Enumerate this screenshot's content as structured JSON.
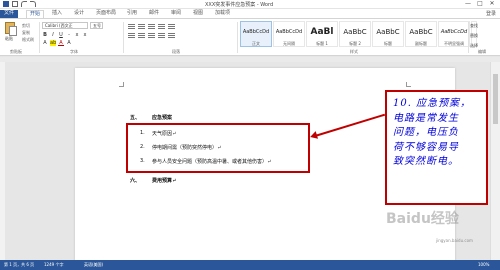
{
  "window": {
    "title": "XXX突发事件应急预案 - Word",
    "minimize": "—",
    "maximize": "□",
    "close": "✕"
  },
  "tabs": [
    {
      "label": "文件"
    },
    {
      "label": "开始"
    },
    {
      "label": "插入"
    },
    {
      "label": "设计"
    },
    {
      "label": "页面布局"
    },
    {
      "label": "引用"
    },
    {
      "label": "邮件"
    },
    {
      "label": "审阅"
    },
    {
      "label": "视图"
    },
    {
      "label": "加载项"
    }
  ],
  "login": "登录",
  "ribbon": {
    "paste_label": "粘贴",
    "cut": "剪切",
    "copy": "复制",
    "format_painter": "格式刷",
    "font_name": "Calibri (西文正",
    "font_size": "五号",
    "bold": "B",
    "italic": "I",
    "underline": "U",
    "groups": {
      "clipboard": "剪贴板",
      "font": "字体",
      "paragraph": "段落",
      "styles": "样式",
      "editing": "编辑"
    },
    "styles": [
      {
        "sample": "AaBbCcDd",
        "name": "正文"
      },
      {
        "sample": "AaBbCcDd",
        "name": "无间隔"
      },
      {
        "sample": "AaBl",
        "name": "标题 1"
      },
      {
        "sample": "AaBbC",
        "name": "标题 2"
      },
      {
        "sample": "AaBbC",
        "name": "标题"
      },
      {
        "sample": "AaBbC",
        "name": "副标题"
      },
      {
        "sample": "AaBbCcDd",
        "name": "不明显强调"
      }
    ],
    "find": "查找",
    "replace": "替换",
    "select": "选择"
  },
  "document": {
    "section5_num": "五、",
    "section5_title": "应急预案",
    "items": [
      {
        "num": "1.",
        "text": "天气原因↵"
      },
      {
        "num": "2.",
        "text": "停电期间需（预防突然停电）↵"
      },
      {
        "num": "3.",
        "text": "参与人员安全问题（预防高温中暑、或者其他伤害）↵"
      }
    ],
    "section6_num": "六、",
    "section6_title": "费用预算↵"
  },
  "annotation": {
    "text": "10. 应急预案，\n电路是常发生\n问题，电压负\n荷不够容易导\n致突然断电。"
  },
  "status": {
    "page": "第 1 页，共 6 页",
    "words": "1249 个字",
    "lang": "英语(美国)",
    "zoom": "100%"
  },
  "watermark": {
    "logo": "Baidu经验",
    "url": "jingyan.baidu.com"
  },
  "colors": {
    "accent": "#2b579a",
    "annotation_border": "#c00000",
    "annotation_text": "#0000dd"
  }
}
